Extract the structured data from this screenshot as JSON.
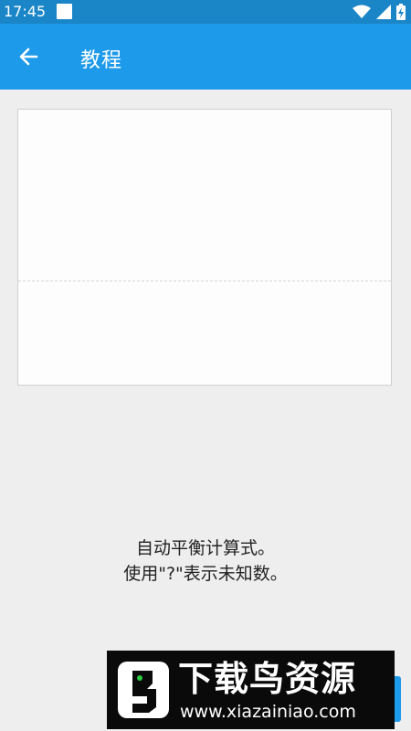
{
  "status_bar": {
    "time": "17:45",
    "icons": [
      "wifi-icon",
      "signal-icon",
      "battery-charging-icon"
    ]
  },
  "app_bar": {
    "title": "教程",
    "back_icon": "arrow-left-icon",
    "background": "#1e9aea"
  },
  "tutorial": {
    "line1": "自动平衡计算式。",
    "line2": "使用\"?\"表示未知数。"
  },
  "watermark": {
    "title": "下载鸟资源",
    "url": "www.xiazainiao.com"
  }
}
